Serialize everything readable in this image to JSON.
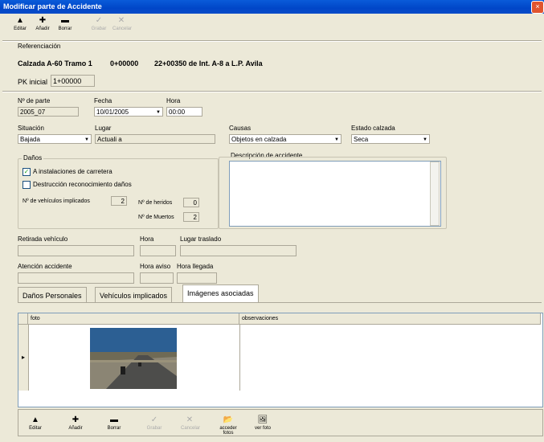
{
  "window": {
    "title": "Modificar parte de Accidente",
    "close_glyph": "×"
  },
  "toolbar": {
    "buttons": [
      {
        "label": "Editar",
        "icon": "▲"
      },
      {
        "label": "Añadir",
        "icon": "✚"
      },
      {
        "label": "Borrar",
        "icon": "▬"
      },
      {
        "label": "Grabar",
        "icon": "✓"
      },
      {
        "label": "Cancelar",
        "icon": "✕"
      }
    ]
  },
  "ref": {
    "label": "Referenciación",
    "title": "Calzada A-60 Tramo 1",
    "pk_range": "0+00000",
    "desc": "22+00350 de Int. A-8 a L.P. Avila",
    "pk_inicial_label": "PK inicial",
    "pk_inicial_value": "1+00000"
  },
  "fields": {
    "parte_label": "Nº de parte",
    "parte_value": "2005_07",
    "fecha_label": "Fecha",
    "fecha_value": "10/01/2005",
    "hora_label": "Hora",
    "hora_value": "00:00",
    "situacion_label": "Situación",
    "situacion_value": "Bajada",
    "lugar_label": "Lugar",
    "lugar_value": "Actuali a",
    "causas_label": "Causas",
    "causas_value": "Objetos en calzada",
    "estado_label": "Estado calzada",
    "estado_value": "Seca"
  },
  "danos": {
    "label": "Daños",
    "chk1": "A instalaciones de carretera",
    "chk2": "Destrucción reconocimiento daños",
    "vehiculos_label": "Nº de vehículos implicados",
    "vehiculos_value": "2",
    "heridos_label": "Nº de heridos",
    "heridos_value": "0",
    "muertos_label": "Nº de Muertos",
    "muertos_value": "2"
  },
  "descripcion": {
    "label": "Descripción de accidente"
  },
  "retirada": {
    "label": "Retirada vehículo",
    "hora_label": "Hora",
    "lugar_label": "Lugar traslado"
  },
  "atencion": {
    "label": "Atención accidente",
    "aviso_label": "Hora aviso",
    "llegada_label": "Hora llegada"
  },
  "tabs": [
    "Daños Personales",
    "Vehículos implicados",
    "Imágenes asociadas"
  ],
  "grid": {
    "col_foto": "foto",
    "col_obs": "observaciones",
    "row_marker": "▸"
  },
  "bottom": {
    "buttons": [
      {
        "label": "Editar",
        "icon": "▲"
      },
      {
        "label": "Añadir",
        "icon": "✚"
      },
      {
        "label": "Borrar",
        "icon": "▬"
      },
      {
        "label": "Grabar",
        "icon": "✓"
      },
      {
        "label": "Cancelar",
        "icon": "✕"
      },
      {
        "label": "acceder fotos",
        "icon": "📂"
      },
      {
        "label": "ver foto",
        "icon": "🖼"
      }
    ]
  }
}
